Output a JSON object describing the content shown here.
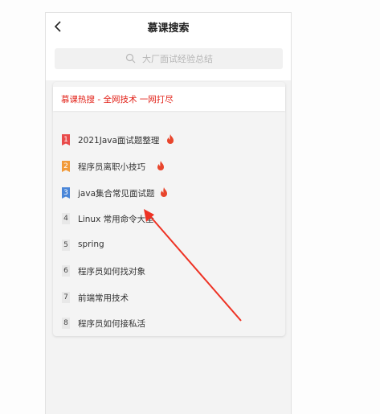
{
  "header": {
    "title": "慕课搜索"
  },
  "search": {
    "placeholder": "大厂面试经验总结"
  },
  "hot": {
    "banner": "慕课热搜 - 全网技术 一网打尽",
    "items": [
      {
        "rank": "1",
        "label": "2021Java面试题整理",
        "hot": true,
        "rank_color": "#e94b4b"
      },
      {
        "rank": "2",
        "label": "程序员离职小技巧",
        "hot": true,
        "rank_color": "#f19a3a"
      },
      {
        "rank": "3",
        "label": "java集合常见面试题",
        "hot": true,
        "rank_color": "#4a86d8"
      },
      {
        "rank": "4",
        "label": "Linux 常用命令大全",
        "hot": false
      },
      {
        "rank": "5",
        "label": "spring",
        "hot": false
      },
      {
        "rank": "6",
        "label": "程序员如何找对象",
        "hot": false
      },
      {
        "rank": "7",
        "label": "前端常用技术",
        "hot": false
      },
      {
        "rank": "8",
        "label": "程序员如何接私活",
        "hot": false
      }
    ]
  },
  "colors": {
    "accent": "#e2231a",
    "annotation_arrow": "#ee3224",
    "fire": "#e8452c"
  }
}
